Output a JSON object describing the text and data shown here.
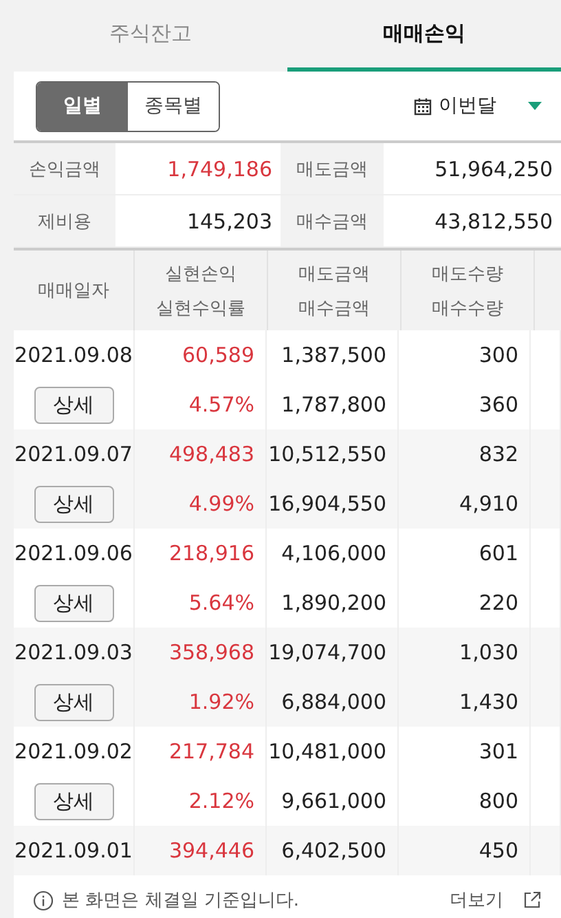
{
  "tabs": [
    {
      "label": "주식잔고",
      "selected": false
    },
    {
      "label": "매매손익",
      "selected": true
    }
  ],
  "view_toggle": [
    {
      "label": "일별",
      "selected": true
    },
    {
      "label": "종목별",
      "selected": false
    }
  ],
  "period": {
    "label": "이번달"
  },
  "summary": [
    {
      "label": "손익금액",
      "value": "1,749,186",
      "kind": "profit"
    },
    {
      "label": "매도금액",
      "value": "51,964,250",
      "kind": "plain"
    },
    {
      "label": "제비용",
      "value": "145,203",
      "kind": "plain"
    },
    {
      "label": "매수금액",
      "value": "43,812,550",
      "kind": "plain"
    }
  ],
  "table": {
    "columns": [
      [
        "매매일자"
      ],
      [
        "실현손익",
        "실현수익률"
      ],
      [
        "매도금액",
        "매수금액"
      ],
      [
        "매도수량",
        "매수수량"
      ]
    ],
    "rows": [
      {
        "date": "2021.09.08",
        "detail": "상세",
        "profit": "60,589",
        "rate": "4.57%",
        "sell_amount": "1,387,500",
        "buy_amount": "1,787,800",
        "sell_qty": "300",
        "buy_qty": "360"
      },
      {
        "date": "2021.09.07",
        "detail": "상세",
        "profit": "498,483",
        "rate": "4.99%",
        "sell_amount": "10,512,550",
        "buy_amount": "16,904,550",
        "sell_qty": "832",
        "buy_qty": "4,910"
      },
      {
        "date": "2021.09.06",
        "detail": "상세",
        "profit": "218,916",
        "rate": "5.64%",
        "sell_amount": "4,106,000",
        "buy_amount": "1,890,200",
        "sell_qty": "601",
        "buy_qty": "220"
      },
      {
        "date": "2021.09.03",
        "detail": "상세",
        "profit": "358,968",
        "rate": "1.92%",
        "sell_amount": "19,074,700",
        "buy_amount": "6,884,000",
        "sell_qty": "1,030",
        "buy_qty": "1,430"
      },
      {
        "date": "2021.09.02",
        "detail": "상세",
        "profit": "217,784",
        "rate": "2.12%",
        "sell_amount": "10,481,000",
        "buy_amount": "9,661,000",
        "sell_qty": "301",
        "buy_qty": "800"
      },
      {
        "date": "2021.09.01",
        "profit": "394,446",
        "sell_amount": "6,402,500",
        "sell_qty": "450"
      }
    ]
  },
  "footer": {
    "note": "본 화면은 체결일 기준입니다.",
    "more": "더보기"
  }
}
